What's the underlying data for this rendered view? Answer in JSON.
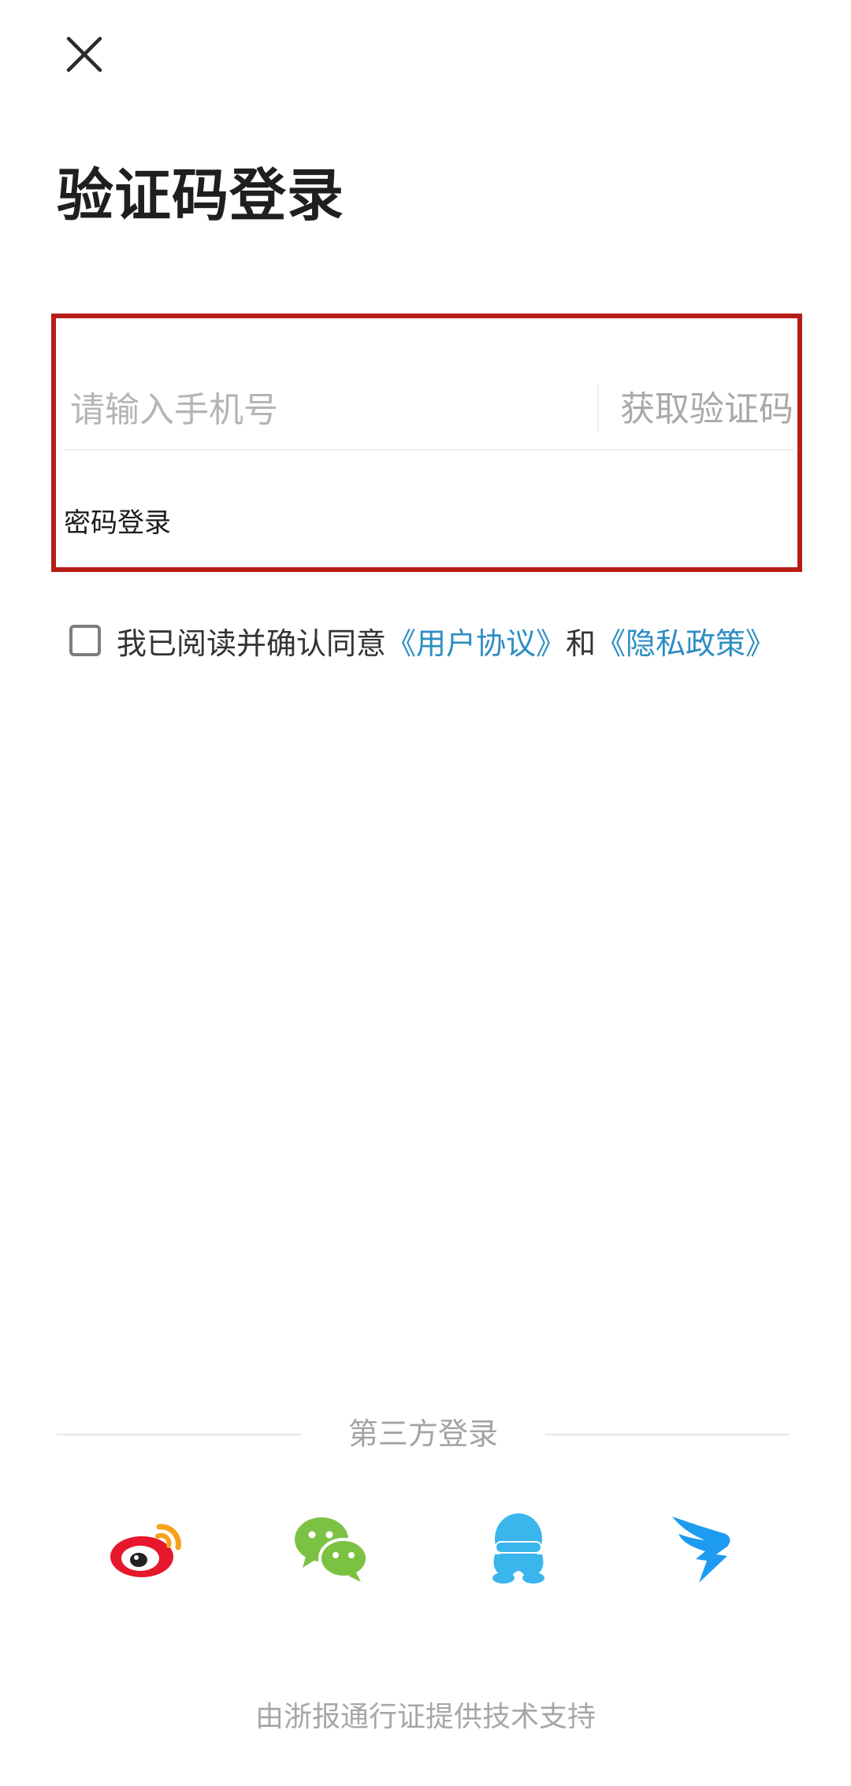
{
  "header": {
    "close_icon": "close-icon",
    "title": "验证码登录"
  },
  "form": {
    "phone_placeholder": "请输入手机号",
    "phone_value": "",
    "get_code_label": "获取验证码",
    "password_login_label": "密码登录",
    "highlight_color": "#b81c16"
  },
  "agreement": {
    "checked": false,
    "text": "我已阅读并确认同意",
    "user_agreement": "《用户协议》",
    "and": "和",
    "privacy_policy": "《隐私政策》",
    "link_color": "#2d8ec3"
  },
  "third_party": {
    "title": "第三方登录",
    "providers": [
      {
        "name": "weibo",
        "icon": "weibo-icon",
        "color": "#e6162d"
      },
      {
        "name": "wechat",
        "icon": "wechat-icon",
        "color": "#7bc243"
      },
      {
        "name": "qq",
        "icon": "qq-icon",
        "color": "#3ab6ec"
      },
      {
        "name": "dingtalk",
        "icon": "dingtalk-icon",
        "color": "#1d9bf0"
      }
    ]
  },
  "footer": {
    "text": "由浙报通行证提供技术支持"
  }
}
